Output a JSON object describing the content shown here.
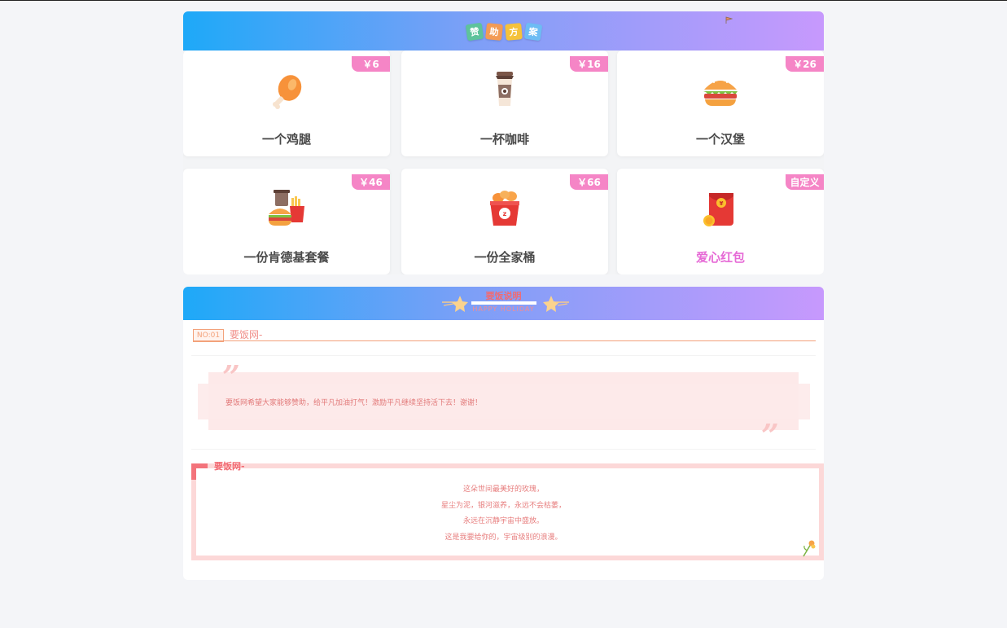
{
  "sponsor": {
    "title_chars": [
      "赞",
      "助",
      "方",
      "案"
    ],
    "items": [
      {
        "label": "一个鸡腿",
        "price": "￥6",
        "icon": "drumstick-icon"
      },
      {
        "label": "一杯咖啡",
        "price": "￥16",
        "icon": "coffee-cup-icon"
      },
      {
        "label": "一个汉堡",
        "price": "￥26",
        "icon": "hamburger-icon"
      },
      {
        "label": "一份肯德基套餐",
        "price": "￥46",
        "icon": "combo-meal-icon"
      },
      {
        "label": "一份全家桶",
        "price": "￥66",
        "icon": "chicken-bucket-icon"
      },
      {
        "label": "爱心红包",
        "price": "自定义",
        "icon": "red-envelope-icon"
      }
    ]
  },
  "notes": {
    "title": "要饭说明",
    "subtitle": "HAPPY HOLIDAY",
    "no_tag": "NO:01",
    "no_title": "要饭网-",
    "quote": "要饭网希望大家能够赞助，给平凡加油打气！激励平凡继续坚持活下去！谢谢！",
    "poem_heading": "要饭网-",
    "poem_lines": [
      "这朵世间最美好的玫瑰，",
      "星尘为泥，银河滋养，永远不会枯萎，",
      "永远在沉静宇宙中盛放。",
      "这是我要给你的，宇宙级别的浪漫。"
    ]
  },
  "colors": {
    "header_gradient_start": "#1ea9f8",
    "header_gradient_end": "#c799fd",
    "badge": "#f585c6",
    "accent_pink": "#e66ad6",
    "note_red": "#f06b73"
  }
}
